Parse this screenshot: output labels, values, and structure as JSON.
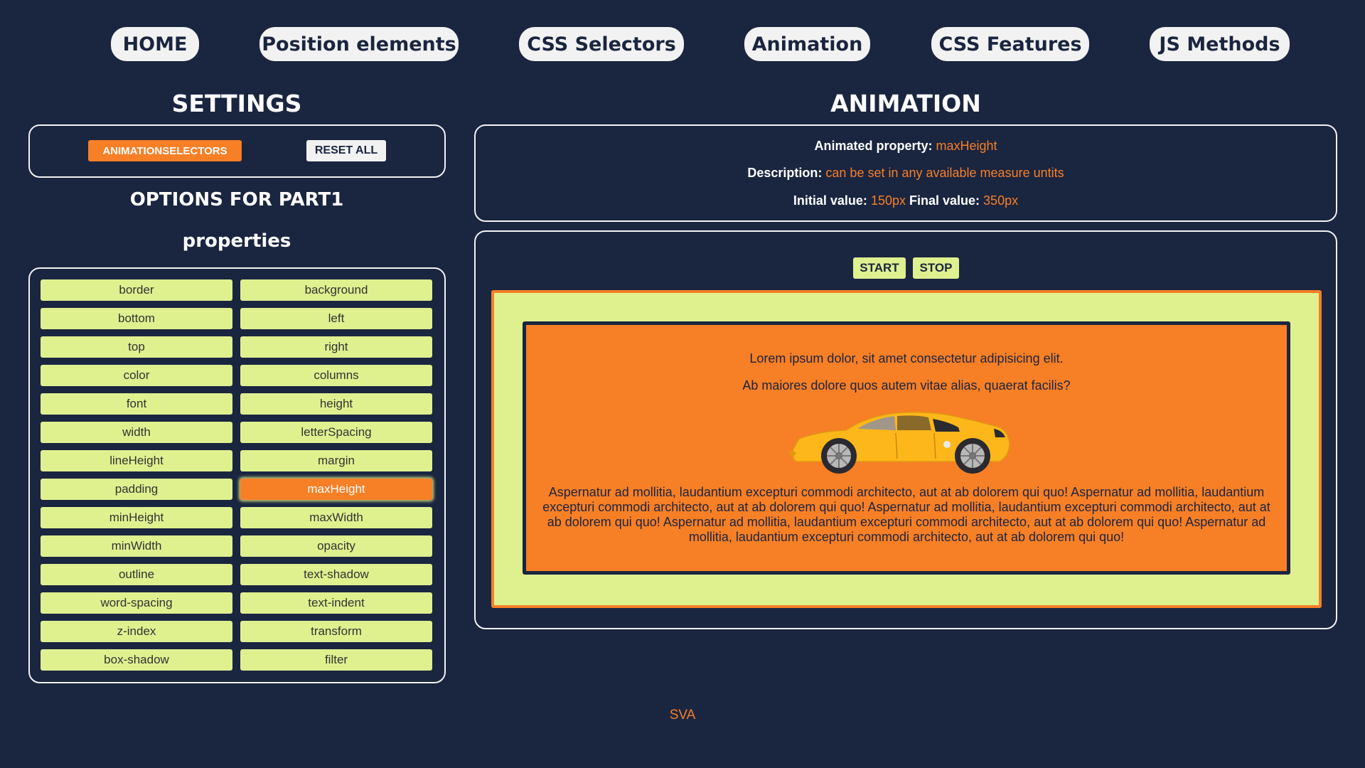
{
  "nav": {
    "items": [
      "HOME",
      "Position elements",
      "CSS Selectors",
      "Animation",
      "CSS Features",
      "JS Methods"
    ]
  },
  "settings": {
    "title": "SETTINGS",
    "animation_selectors_label": "ANIMATIONSELECTORS",
    "reset_all_label": "RESET ALL",
    "options_title": "OPTIONS FOR PART1",
    "properties_title": "properties",
    "properties": [
      "border",
      "background",
      "bottom",
      "left",
      "top",
      "right",
      "color",
      "columns",
      "font",
      "height",
      "width",
      "letterSpacing",
      "lineHeight",
      "margin",
      "padding",
      "maxHeight",
      "minHeight",
      "maxWidth",
      "minWidth",
      "opacity",
      "outline",
      "text-shadow",
      "word-spacing",
      "text-indent",
      "z-index",
      "transform",
      "box-shadow",
      "filter"
    ],
    "selected_property": "maxHeight"
  },
  "animation": {
    "title": "ANIMATION",
    "animated_property_label": "Animated property:",
    "animated_property_value": "maxHeight",
    "description_label": "Description:",
    "description_value": "can be set in any available measure untits",
    "initial_label": "Initial value:",
    "initial_value": "150px",
    "final_label": "Final value:",
    "final_value": "350px",
    "start_label": "START",
    "stop_label": "STOP",
    "stage": {
      "line1": "Lorem ipsum dolor, sit amet consectetur adipisicing elit.",
      "line2": "Ab maiores dolore quos autem vitae alias, quaerat facilis?",
      "paragraph": "Aspernatur ad mollitia, laudantium excepturi commodi architecto, aut at ab dolorem qui quo! Aspernatur ad mollitia, laudantium excepturi commodi architecto, aut at ab dolorem qui quo! Aspernatur ad mollitia, laudantium excepturi commodi architecto, aut at ab dolorem qui quo! Aspernatur ad mollitia, laudantium excepturi commodi architecto, aut at ab dolorem qui quo! Aspernatur ad mollitia, laudantium excepturi commodi architecto, aut at ab dolorem qui quo!"
    }
  },
  "footer": {
    "text": "SVA"
  },
  "colors": {
    "background": "#1a2540",
    "accent": "#f77f26",
    "button": "#dff08f",
    "nav_button": "#f2f2f2"
  },
  "icons": {
    "car": "car-illustration"
  }
}
